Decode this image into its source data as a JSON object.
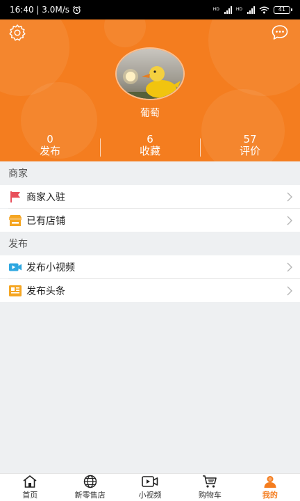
{
  "status_bar": {
    "time_speed": "16:40 | 3.0M/s",
    "battery": "41",
    "network_label": "HD"
  },
  "profile": {
    "username": "葡萄",
    "stats": [
      {
        "value": "0",
        "label": "发布"
      },
      {
        "value": "6",
        "label": "收藏"
      },
      {
        "value": "57",
        "label": "评价"
      }
    ]
  },
  "sections": {
    "merchant": {
      "title": "商家",
      "items": [
        {
          "label": "商家入驻",
          "icon": "flag-icon"
        },
        {
          "label": "已有店铺",
          "icon": "store-icon"
        }
      ]
    },
    "publish": {
      "title": "发布",
      "items": [
        {
          "label": "发布小视频",
          "icon": "video-icon"
        },
        {
          "label": "发布头条",
          "icon": "news-icon"
        }
      ]
    }
  },
  "tabbar": {
    "tabs": [
      {
        "label": "首页",
        "icon": "home-icon"
      },
      {
        "label": "新零售店",
        "icon": "globe-icon"
      },
      {
        "label": "小视频",
        "icon": "video-play-icon"
      },
      {
        "label": "购物车",
        "icon": "cart-icon"
      },
      {
        "label": "我的",
        "icon": "user-icon"
      }
    ],
    "active_index": 4
  },
  "colors": {
    "accent": "#f47d1f",
    "flag": "#e8505b",
    "store": "#f5a623",
    "video": "#2ea7e0",
    "news": "#f5a623"
  }
}
